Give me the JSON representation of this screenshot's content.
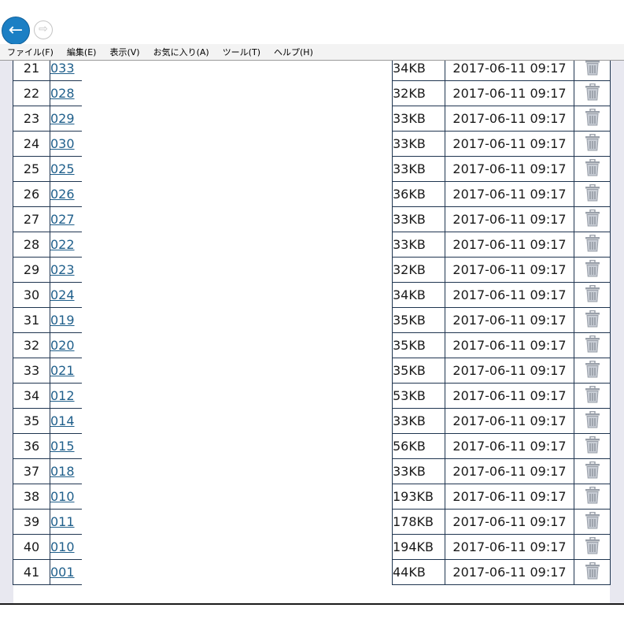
{
  "nav": {
    "back_icon": "arrow-left-icon",
    "forward_icon": "arrow-right-icon",
    "back_color": "#1b7fc4"
  },
  "menu": {
    "items": [
      {
        "label": "ファイル(F)"
      },
      {
        "label": "編集(E)"
      },
      {
        "label": "表示(V)"
      },
      {
        "label": "お気に入り(A)"
      },
      {
        "label": "ツール(T)"
      },
      {
        "label": "ヘルプ(H)"
      }
    ]
  },
  "table": {
    "row_icon": "trash-icon",
    "rows": [
      {
        "no": "21",
        "name": "033",
        "size": "34KB",
        "date": "2017-06-11 09:17"
      },
      {
        "no": "22",
        "name": "028",
        "size": "32KB",
        "date": "2017-06-11 09:17"
      },
      {
        "no": "23",
        "name": "029",
        "size": "33KB",
        "date": "2017-06-11 09:17"
      },
      {
        "no": "24",
        "name": "030",
        "size": "33KB",
        "date": "2017-06-11 09:17"
      },
      {
        "no": "25",
        "name": "025",
        "size": "33KB",
        "date": "2017-06-11 09:17"
      },
      {
        "no": "26",
        "name": "026",
        "size": "36KB",
        "date": "2017-06-11 09:17"
      },
      {
        "no": "27",
        "name": "027",
        "size": "33KB",
        "date": "2017-06-11 09:17"
      },
      {
        "no": "28",
        "name": "022",
        "size": "33KB",
        "date": "2017-06-11 09:17"
      },
      {
        "no": "29",
        "name": "023",
        "size": "32KB",
        "date": "2017-06-11 09:17"
      },
      {
        "no": "30",
        "name": "024",
        "size": "34KB",
        "date": "2017-06-11 09:17"
      },
      {
        "no": "31",
        "name": "019",
        "size": "35KB",
        "date": "2017-06-11 09:17"
      },
      {
        "no": "32",
        "name": "020",
        "size": "35KB",
        "date": "2017-06-11 09:17"
      },
      {
        "no": "33",
        "name": "021",
        "size": "35KB",
        "date": "2017-06-11 09:17"
      },
      {
        "no": "34",
        "name": "012",
        "size": "53KB",
        "date": "2017-06-11 09:17"
      },
      {
        "no": "35",
        "name": "014",
        "size": "33KB",
        "date": "2017-06-11 09:17"
      },
      {
        "no": "36",
        "name": "015",
        "size": "56KB",
        "date": "2017-06-11 09:17"
      },
      {
        "no": "37",
        "name": "018",
        "size": "33KB",
        "date": "2017-06-11 09:17"
      },
      {
        "no": "38",
        "name": "010",
        "size": "193KB",
        "date": "2017-06-11 09:17"
      },
      {
        "no": "39",
        "name": "011",
        "size": "178KB",
        "date": "2017-06-11 09:17"
      },
      {
        "no": "40",
        "name": "010",
        "size": "194KB",
        "date": "2017-06-11 09:17"
      },
      {
        "no": "41",
        "name": "001",
        "size": "44KB",
        "date": "2017-06-11 09:17"
      }
    ]
  }
}
